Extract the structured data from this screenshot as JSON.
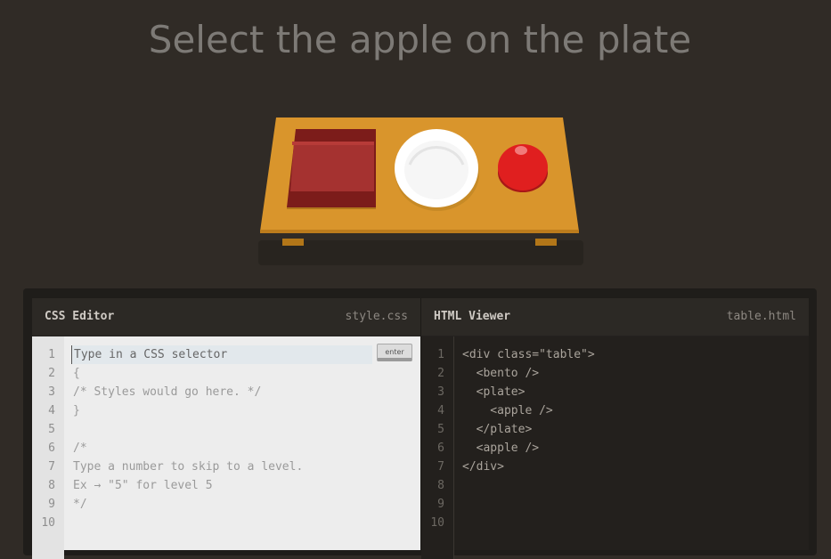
{
  "title": "Select the apple on the plate",
  "css_editor": {
    "title": "CSS Editor",
    "file": "style.css",
    "input_placeholder": "Type in a CSS selector",
    "enter_label": "enter",
    "line_numbers": [
      "1",
      "2",
      "3",
      "4",
      "5",
      "6",
      "7",
      "8",
      "9",
      "10"
    ],
    "lines": [
      "{",
      "/* Styles would go here. */",
      "}",
      "",
      "/*",
      "Type a number to skip to a level.",
      "Ex → \"5\" for level 5",
      "*/"
    ]
  },
  "html_viewer": {
    "title": "HTML Viewer",
    "file": "table.html",
    "line_numbers": [
      "1",
      "2",
      "3",
      "4",
      "5",
      "6",
      "7",
      "8",
      "9",
      "10"
    ],
    "lines": [
      "<div class=\"table\">",
      "  <bento />",
      "  <plate>",
      "    <apple />",
      "  </plate>",
      "  <apple />",
      "</div>",
      "",
      "",
      ""
    ]
  },
  "colors": {
    "background": "#302b26",
    "table": "#d9952c",
    "bento": "#8a2320",
    "plate": "#ffffff",
    "apple": "#e01f1f"
  }
}
